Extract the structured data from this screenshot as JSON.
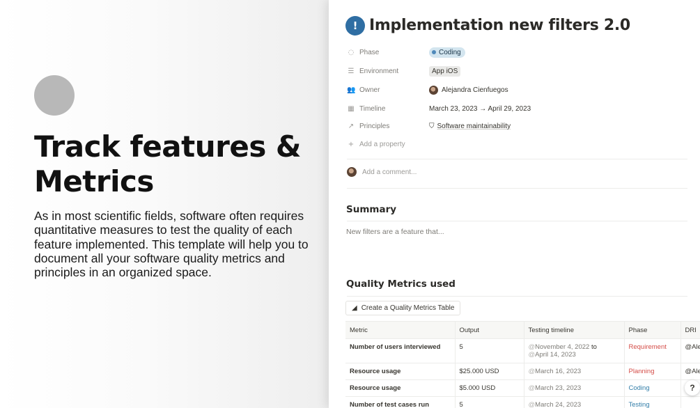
{
  "marketing": {
    "headline": "Track features & Metrics",
    "body": "As in most scientific fields, software often requires quantitative measures to test the quality of each feature implemented. This template will help you to document all your software quality metrics and principles in an organized space."
  },
  "page": {
    "icon": "exclamation-badge-icon",
    "title": "Implementation new filters 2.0",
    "properties": [
      {
        "icon": "phase-icon",
        "label": "Phase",
        "value": "Coding"
      },
      {
        "icon": "list-icon",
        "label": "Environment",
        "value": "App iOS"
      },
      {
        "icon": "people-icon",
        "label": "Owner",
        "value": "Alejandra Cienfuegos"
      },
      {
        "icon": "calendar-icon",
        "label": "Timeline",
        "value": "March 23, 2023 → April 29, 2023"
      },
      {
        "icon": "arrow-up-right-icon",
        "label": "Principles",
        "value": "Software maintainability"
      }
    ],
    "add_property": "Add a property",
    "comment_placeholder": "Add a comment...",
    "summary_heading": "Summary",
    "summary_text": "New filters are a feature that...",
    "metrics_heading": "Quality Metrics used",
    "create_button": "Create a Quality Metrics Table",
    "table": {
      "headers": [
        "Metric",
        "Output",
        "Testing timeline",
        "Phase",
        "DRI"
      ],
      "rows": [
        {
          "metric": "Number of users interviewed",
          "output": "5",
          "timeline": "@November 4, 2022 to @April 14, 2023",
          "phase": "Requirement",
          "dri": "@Ale"
        },
        {
          "metric": "Resource usage",
          "output": "$25.000 USD",
          "timeline": "@March 16, 2023",
          "phase": "Planning",
          "dri": "@Ale"
        },
        {
          "metric": "Resource usage",
          "output": "$5.000 USD",
          "timeline": "@March 23, 2023",
          "phase": "Coding",
          "dri": ""
        },
        {
          "metric": "Number of test cases run",
          "output": "5",
          "timeline": "@March 24, 2023",
          "phase": "Testing",
          "dri": ""
        }
      ]
    }
  },
  "help_label": "?",
  "colors": {
    "accent_blue": "#337ea9",
    "accent_red": "#d44c47",
    "chip_blue": "#d3e5ef",
    "icon_blue": "#2f6ea3"
  }
}
